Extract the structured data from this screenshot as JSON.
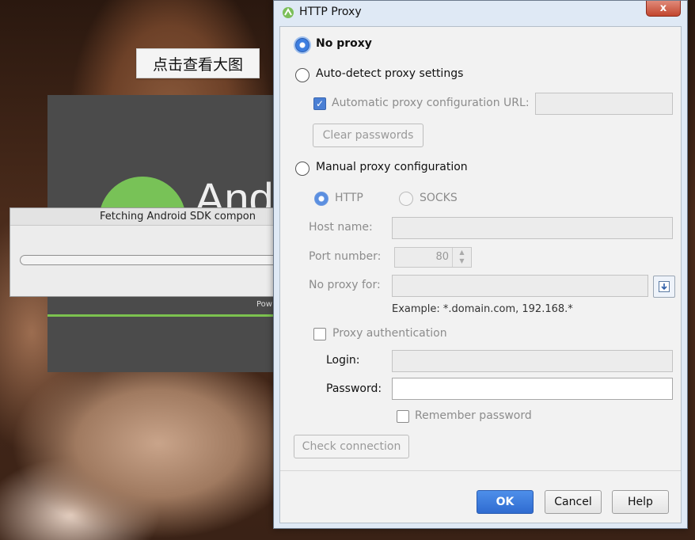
{
  "background": {
    "thumb_label": "点击查看大图"
  },
  "splash": {
    "word": "And",
    "powered": "Pow",
    "fetch_title": "Fetching Android SDK compon"
  },
  "dialog": {
    "title": "HTTP Proxy",
    "close_label": "x",
    "no_proxy": "No proxy",
    "auto_detect": "Auto-detect proxy settings",
    "auto_config_url": "Automatic proxy configuration URL:",
    "clear_passwords": "Clear passwords",
    "manual": "Manual proxy configuration",
    "http": "HTTP",
    "socks": "SOCKS",
    "host_name": "Host name:",
    "port_number": "Port number:",
    "port_value": "80",
    "no_proxy_for": "No proxy for:",
    "example": "Example: *.domain.com, 192.168.*",
    "proxy_auth": "Proxy authentication",
    "login": "Login:",
    "password": "Password:",
    "remember_password": "Remember password",
    "check_connection": "Check connection",
    "ok": "OK",
    "cancel": "Cancel",
    "help": "Help"
  },
  "state": {
    "selected_proxy": "No proxy",
    "selected_protocol": "HTTP",
    "auto_config_checked": true,
    "proxy_auth_checked": false,
    "remember_password_checked": false
  },
  "colors": {
    "primary_button": "#3b7be0",
    "android_green": "#78c257"
  }
}
